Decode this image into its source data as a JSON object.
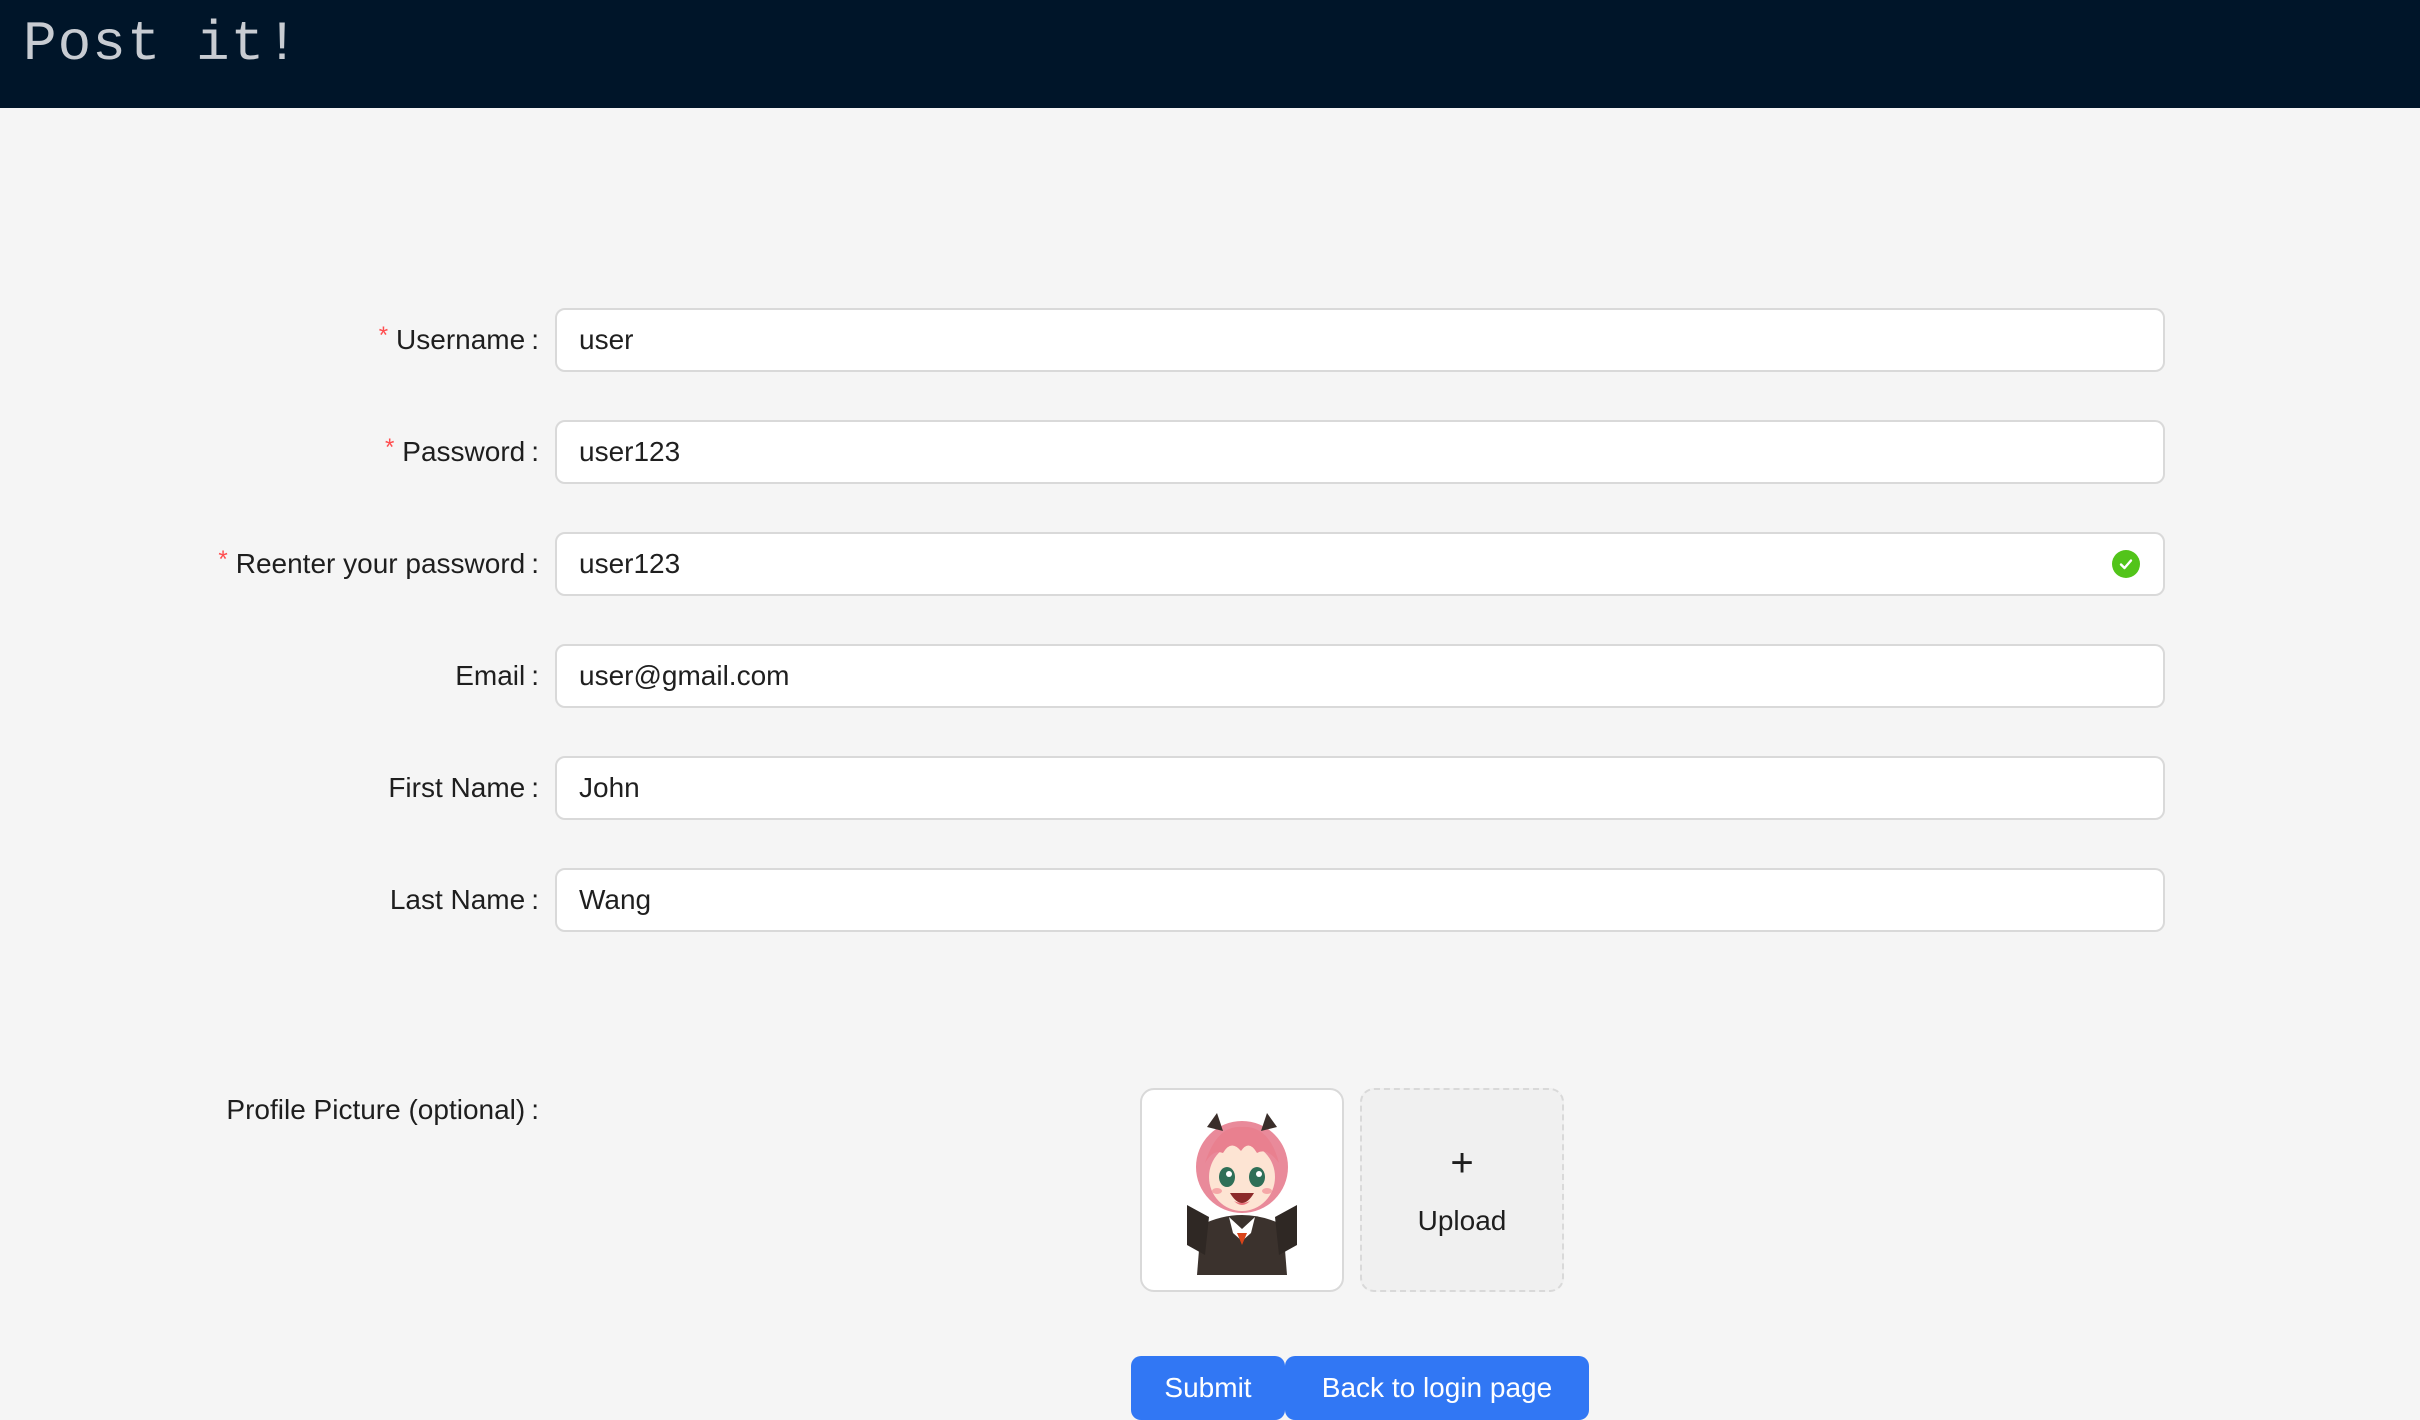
{
  "header": {
    "brand": "Post it!"
  },
  "form": {
    "fields": [
      {
        "label": "Username",
        "required": true,
        "value": "user"
      },
      {
        "label": "Password",
        "required": true,
        "value": "user123"
      },
      {
        "label": "Reenter your password",
        "required": true,
        "value": "user123",
        "valid": true
      },
      {
        "label": "Email",
        "required": false,
        "value": "user@gmail.com"
      },
      {
        "label": "First Name",
        "required": false,
        "value": "John"
      },
      {
        "label": "Last Name",
        "required": false,
        "value": "Wang"
      }
    ],
    "profile_label": "Profile Picture (optional)",
    "upload_label": "Upload",
    "upload_icon": "plus-icon",
    "submit_label": "Submit",
    "back_label": "Back to login page"
  },
  "colors": {
    "header_bg": "#001529",
    "primary": "#3177f4",
    "required": "#ff4d4f",
    "success": "#52c41a"
  }
}
